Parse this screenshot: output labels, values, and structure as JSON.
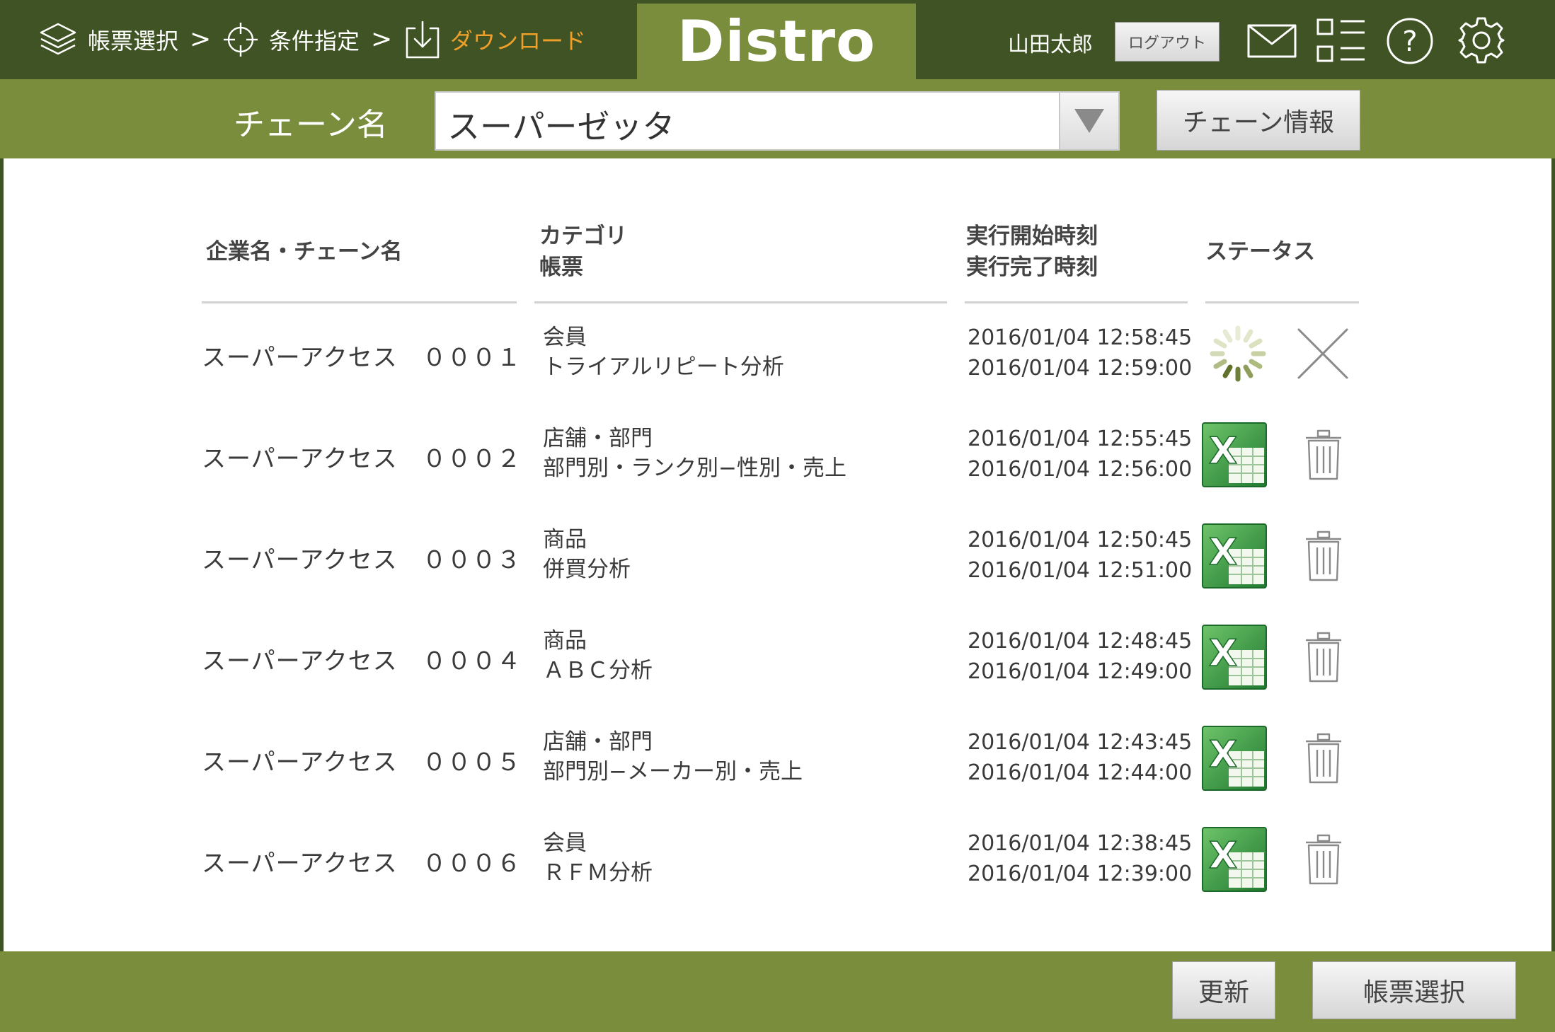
{
  "header": {
    "breadcrumbs": [
      {
        "label": "帳票選択",
        "icon": "layers-icon",
        "active": false
      },
      {
        "label": "条件指定",
        "icon": "crosshair-icon",
        "active": false
      },
      {
        "label": "ダウンロード",
        "icon": "download-icon",
        "active": true
      }
    ],
    "separator": ">",
    "logo": "Distro",
    "user_name": "山田太郎",
    "logout_label": "ログアウト",
    "icons": [
      "mail-icon",
      "list-view-icon",
      "help-icon",
      "settings-icon"
    ]
  },
  "chain_bar": {
    "label": "チェーン名",
    "selected_value": "スーパーゼッタ",
    "info_button_label": "チェーン情報"
  },
  "table": {
    "headers": {
      "company": "企業名・チェーン名",
      "category_line1": "カテゴリ",
      "category_line2": "帳票",
      "time_line1": "実行開始時刻",
      "time_line2": "実行完了時刻",
      "status": "ステータス"
    },
    "rows": [
      {
        "company": "スーパーアクセス　０００１",
        "category": "会員",
        "report": "トライアルリピート分析",
        "start": "2016/01/04  12:58:45",
        "end": "2016/01/04  12:59:00",
        "status": "processing",
        "status_icon": "loading-spinner-icon",
        "action_icon": "cancel-icon"
      },
      {
        "company": "スーパーアクセス　０００２",
        "category": "店舗・部門",
        "report": "部門別・ランク別−性別・売上",
        "start": "2016/01/04  12:55:45",
        "end": "2016/01/04  12:56:00",
        "status": "done",
        "status_icon": "excel-file-icon",
        "action_icon": "trash-icon"
      },
      {
        "company": "スーパーアクセス　０００３",
        "category": "商品",
        "report": "併買分析",
        "start": "2016/01/04  12:50:45",
        "end": "2016/01/04  12:51:00",
        "status": "done",
        "status_icon": "excel-file-icon",
        "action_icon": "trash-icon"
      },
      {
        "company": "スーパーアクセス　０００４",
        "category": "商品",
        "report": "ＡＢＣ分析",
        "start": "2016/01/04  12:48:45",
        "end": "2016/01/04  12:49:00",
        "status": "done",
        "status_icon": "excel-file-icon",
        "action_icon": "trash-icon"
      },
      {
        "company": "スーパーアクセス　０００５",
        "category": "店舗・部門",
        "report": "部門別−メーカー別・売上",
        "start": "2016/01/04  12:43:45",
        "end": "2016/01/04  12:44:00",
        "status": "done",
        "status_icon": "excel-file-icon",
        "action_icon": "trash-icon"
      },
      {
        "company": "スーパーアクセス　０００６",
        "category": "会員",
        "report": "ＲＦＭ分析",
        "start": "2016/01/04  12:38:45",
        "end": "2016/01/04  12:39:00",
        "status": "done",
        "status_icon": "excel-file-icon",
        "action_icon": "trash-icon"
      }
    ]
  },
  "footer": {
    "refresh_label": "更新",
    "report_select_label": "帳票選択"
  },
  "colors": {
    "header_dark": "#3f5324",
    "olive": "#7a8d3c",
    "active_orange": "#f0a02a",
    "excel_green": "#2e8a3a"
  }
}
